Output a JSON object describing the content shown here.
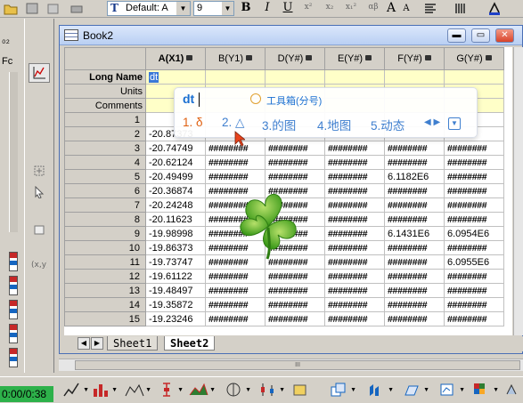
{
  "toolbar": {
    "font_name": "Default: A",
    "font_size": "9",
    "bold_label": "B",
    "italic_label": "I",
    "underline_label": "U",
    "superscript_label": "x²",
    "subscript_label": "x₂",
    "supersub_label": "x₁²",
    "greek_label": "αβ",
    "bigger_label": "A",
    "smaller_label": "A",
    "icons": [
      "open-icon",
      "save-icon",
      "font-icon",
      "align-icon",
      "pattern-icon",
      "font-color-icon"
    ]
  },
  "left_strip": {
    "frag1": "₀₂",
    "frag2": "Fc"
  },
  "workbook": {
    "title": "Book2",
    "minimize_label": "▬",
    "restore_label": "▭",
    "close_label": "✕",
    "columns": [
      {
        "name": "A(X1)",
        "plot": "x"
      },
      {
        "name": "B(Y1)",
        "plot": "y"
      },
      {
        "name": "D(Y#)",
        "plot": "y"
      },
      {
        "name": "E(Y#)",
        "plot": "y"
      },
      {
        "name": "F(Y#)",
        "plot": "y"
      },
      {
        "name": "G(Y#)",
        "plot": "y"
      }
    ],
    "meta_labels": {
      "long_name": "Long Name",
      "units": "Units",
      "comments": "Comments"
    },
    "editing_cell_value": "dt",
    "rows": [
      {
        "n": "1",
        "a": "",
        "b": "",
        "d": "",
        "e": "",
        "f": "",
        "g": ""
      },
      {
        "n": "2",
        "a": "-20.87373",
        "b": "",
        "d": "",
        "e": "",
        "f": "",
        "g": ""
      },
      {
        "n": "3",
        "a": "-20.74749",
        "b": "########",
        "d": "########",
        "e": "########",
        "f": "########",
        "g": "########"
      },
      {
        "n": "4",
        "a": "-20.62124",
        "b": "########",
        "d": "########",
        "e": "########",
        "f": "########",
        "g": "########"
      },
      {
        "n": "5",
        "a": "-20.49499",
        "b": "########",
        "d": "########",
        "e": "########",
        "f": "6.1182E6",
        "g": "########"
      },
      {
        "n": "6",
        "a": "-20.36874",
        "b": "########",
        "d": "########",
        "e": "########",
        "f": "########",
        "g": "########"
      },
      {
        "n": "7",
        "a": "-20.24248",
        "b": "########",
        "d": "########",
        "e": "########",
        "f": "########",
        "g": "########"
      },
      {
        "n": "8",
        "a": "-20.11623",
        "b": "########",
        "d": "########",
        "e": "########",
        "f": "########",
        "g": "########"
      },
      {
        "n": "9",
        "a": "-19.98998",
        "b": "########",
        "d": "########",
        "e": "########",
        "f": "6.1431E6",
        "g": "6.0954E6"
      },
      {
        "n": "10",
        "a": "-19.86373",
        "b": "########",
        "d": "########",
        "e": "########",
        "f": "########",
        "g": "########"
      },
      {
        "n": "11",
        "a": "-19.73747",
        "b": "########",
        "d": "########",
        "e": "########",
        "f": "########",
        "g": "6.0955E6"
      },
      {
        "n": "12",
        "a": "-19.61122",
        "b": "########",
        "d": "########",
        "e": "########",
        "f": "########",
        "g": "########"
      },
      {
        "n": "13",
        "a": "-19.48497",
        "b": "########",
        "d": "########",
        "e": "########",
        "f": "########",
        "g": "########"
      },
      {
        "n": "14",
        "a": "-19.35872",
        "b": "########",
        "d": "########",
        "e": "########",
        "f": "########",
        "g": "########"
      },
      {
        "n": "15",
        "a": "-19.23246",
        "b": "########",
        "d": "########",
        "e": "########",
        "f": "########",
        "g": "########"
      }
    ],
    "sheets": [
      {
        "label": "Sheet1",
        "active": false
      },
      {
        "label": "Sheet2",
        "active": true
      }
    ]
  },
  "ime": {
    "composition": "dt",
    "toolbox_label": "工具箱(分号)",
    "candidates": [
      "1. δ",
      "2. △",
      "3.的图",
      "4.地图",
      "5.动态"
    ],
    "pager_label": "◀ ▶",
    "more_label": "▼"
  },
  "status": {
    "timer": "0:00/0:38",
    "hscroll_grip": "III"
  },
  "colors": {
    "accent": "#1a6fd1",
    "timer_bg": "#2db14a",
    "meta_bg": "#ffffc8",
    "close_btn": "#d8432a"
  }
}
